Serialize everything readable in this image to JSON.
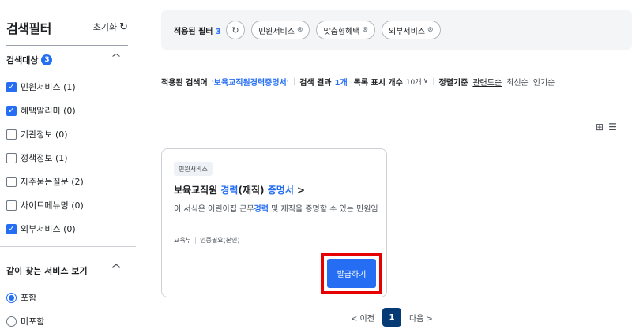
{
  "sidebar": {
    "title": "검색필터",
    "reset_label": "초기화",
    "reset_icon": "refresh-icon",
    "search_target": {
      "title": "검색대상",
      "count": "3",
      "items": [
        {
          "label": "민원서비스 (1)",
          "checked": true
        },
        {
          "label": "혜택알리미 (0)",
          "checked": true
        },
        {
          "label": "기관정보 (0)",
          "checked": false
        },
        {
          "label": "정책정보 (1)",
          "checked": false
        },
        {
          "label": "자주묻는질문 (2)",
          "checked": false
        },
        {
          "label": "사이트메뉴명 (0)",
          "checked": false
        },
        {
          "label": "외부서비스 (0)",
          "checked": true
        }
      ]
    },
    "related": {
      "title": "같이 찾는 서비스 보기",
      "options": [
        {
          "label": "포함",
          "checked": true
        },
        {
          "label": "미포함",
          "checked": false
        }
      ]
    }
  },
  "filter_bar": {
    "label": "적용된 필터",
    "count": "3",
    "chips": [
      {
        "label": "민원서비스"
      },
      {
        "label": "맞춤형혜택"
      },
      {
        "label": "외부서비스"
      }
    ]
  },
  "results_info": {
    "prefix": "적용된 검색어",
    "keyword": "'보육교직원경력증명서'",
    "result_label": "검색 결과",
    "result_count": "1개",
    "per_page_label": "목록 표시 개수",
    "per_page_value": "10개",
    "sort_label": "정렬기준",
    "sort_options": [
      {
        "label": "관련도순",
        "active": true
      },
      {
        "label": "최신순",
        "active": false
      },
      {
        "label": "인기순",
        "active": false
      }
    ]
  },
  "card": {
    "tag": "민원서비스",
    "title_parts": [
      "보육교직원",
      "경력",
      "(재직)",
      "증명서",
      ">"
    ],
    "desc_parts": [
      "이 서식은 어린이집 근무",
      "경력",
      "및 재직을 증명할 수 있는 민원임"
    ],
    "meta": [
      "교육부",
      "인증필요(본인)"
    ],
    "button_label": "발급하기"
  },
  "pagination": {
    "prev_label": "< 이전",
    "current_page": "1",
    "next_label": "다음 >"
  },
  "colors": {
    "accent": "#256ef4",
    "page_active": "#063a74",
    "highlight_box": "#e60000"
  }
}
